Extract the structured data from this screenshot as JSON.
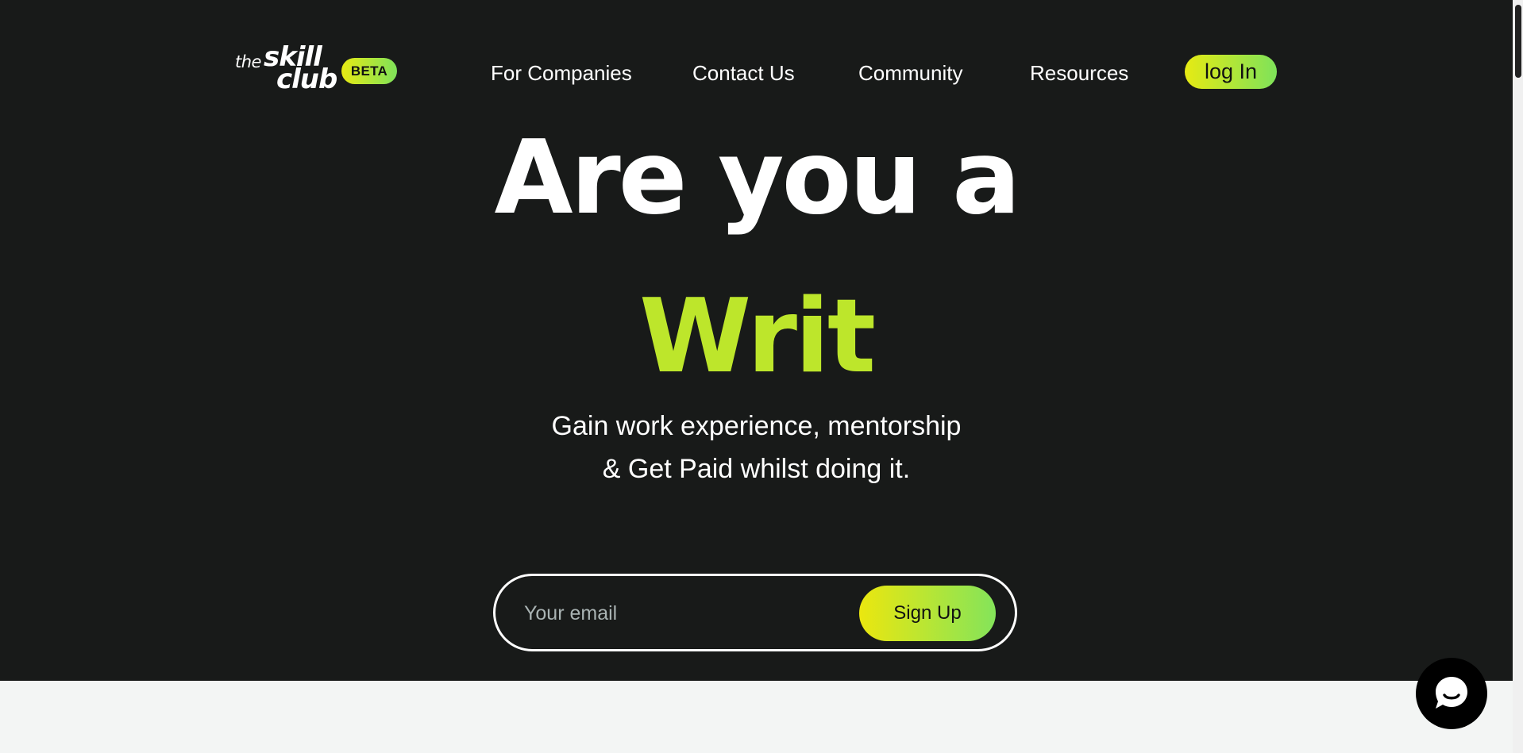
{
  "brand": {
    "logo_the": "the",
    "logo_skill": "skill",
    "logo_club": "club",
    "badge": "BETA"
  },
  "nav": {
    "items": [
      {
        "label": "For Companies"
      },
      {
        "label": "Contact Us"
      },
      {
        "label": "Community"
      },
      {
        "label": "Resources"
      }
    ],
    "login_label": "log In"
  },
  "hero": {
    "line1": "Are you a",
    "line2": "Writ",
    "subtitle_line1": "Gain work experience, mentorship",
    "subtitle_line2": "& Get Paid whilst doing it."
  },
  "signup": {
    "email_placeholder": "Your email",
    "email_value": "",
    "button_label": "Sign Up"
  },
  "colors": {
    "background": "#181a19",
    "accent_green": "#bde62b",
    "gradient_start": "#e8ea13",
    "gradient_end": "#7ee25a",
    "below_section": "#f3f5f4"
  },
  "icons": {
    "chat": "chat-bubble-icon"
  }
}
